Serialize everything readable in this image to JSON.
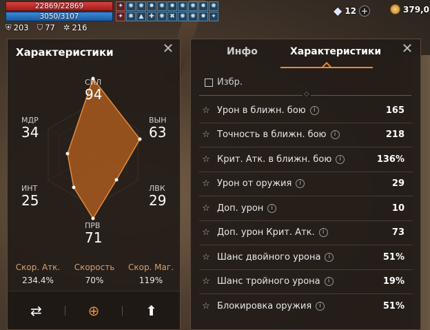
{
  "hud": {
    "hp_text": "22869/22869",
    "mp_text": "3050/3107",
    "stats": [
      {
        "icon": "shield-icon",
        "value": "203"
      },
      {
        "icon": "armor-icon",
        "value": "77"
      },
      {
        "icon": "gear-star-icon",
        "value": "216"
      }
    ],
    "gems": "12",
    "gold": "379,0",
    "colors": {
      "hp": "#d84040",
      "mp": "#3a8ad8",
      "accent": "#e68a3a"
    }
  },
  "left_panel": {
    "title": "Характеристики",
    "stats": {
      "str": {
        "label": "СИЛ",
        "value": "94"
      },
      "vit": {
        "label": "ВЫН",
        "value": "63"
      },
      "dex": {
        "label": "ЛВК",
        "value": "29"
      },
      "agi": {
        "label": "ПРВ",
        "value": "71"
      },
      "int": {
        "label": "ИНТ",
        "value": "25"
      },
      "wis": {
        "label": "МДР",
        "value": "34"
      }
    },
    "speeds": [
      {
        "label": "Скор. Атк.",
        "value": "234.4%"
      },
      {
        "label": "Скорость",
        "value": "70%"
      },
      {
        "label": "Скор. Маг.",
        "value": "119%"
      }
    ],
    "bottom_actions": [
      "swap-icon",
      "zoom-icon",
      "arrow-up-icon"
    ]
  },
  "right_panel": {
    "tabs": [
      "Инфо",
      "Характеристики"
    ],
    "active_tab": "Характеристики",
    "favorites_label": "Избр.",
    "rows": [
      {
        "name": "Урон в ближн. бою",
        "value": "165"
      },
      {
        "name": "Точность в ближн. бою",
        "value": "218"
      },
      {
        "name": "Крит. Атк. в ближн. бою",
        "value": "136%"
      },
      {
        "name": "Урон от оружия",
        "value": "29"
      },
      {
        "name": "Доп. урон",
        "value": "10"
      },
      {
        "name": "Доп. урон Крит. Атк.",
        "value": "73"
      },
      {
        "name": "Шанс двойного урона",
        "value": "51%"
      },
      {
        "name": "Шанс тройного урона",
        "value": "19%"
      },
      {
        "name": "Блокировка оружия",
        "value": "51%"
      }
    ]
  }
}
